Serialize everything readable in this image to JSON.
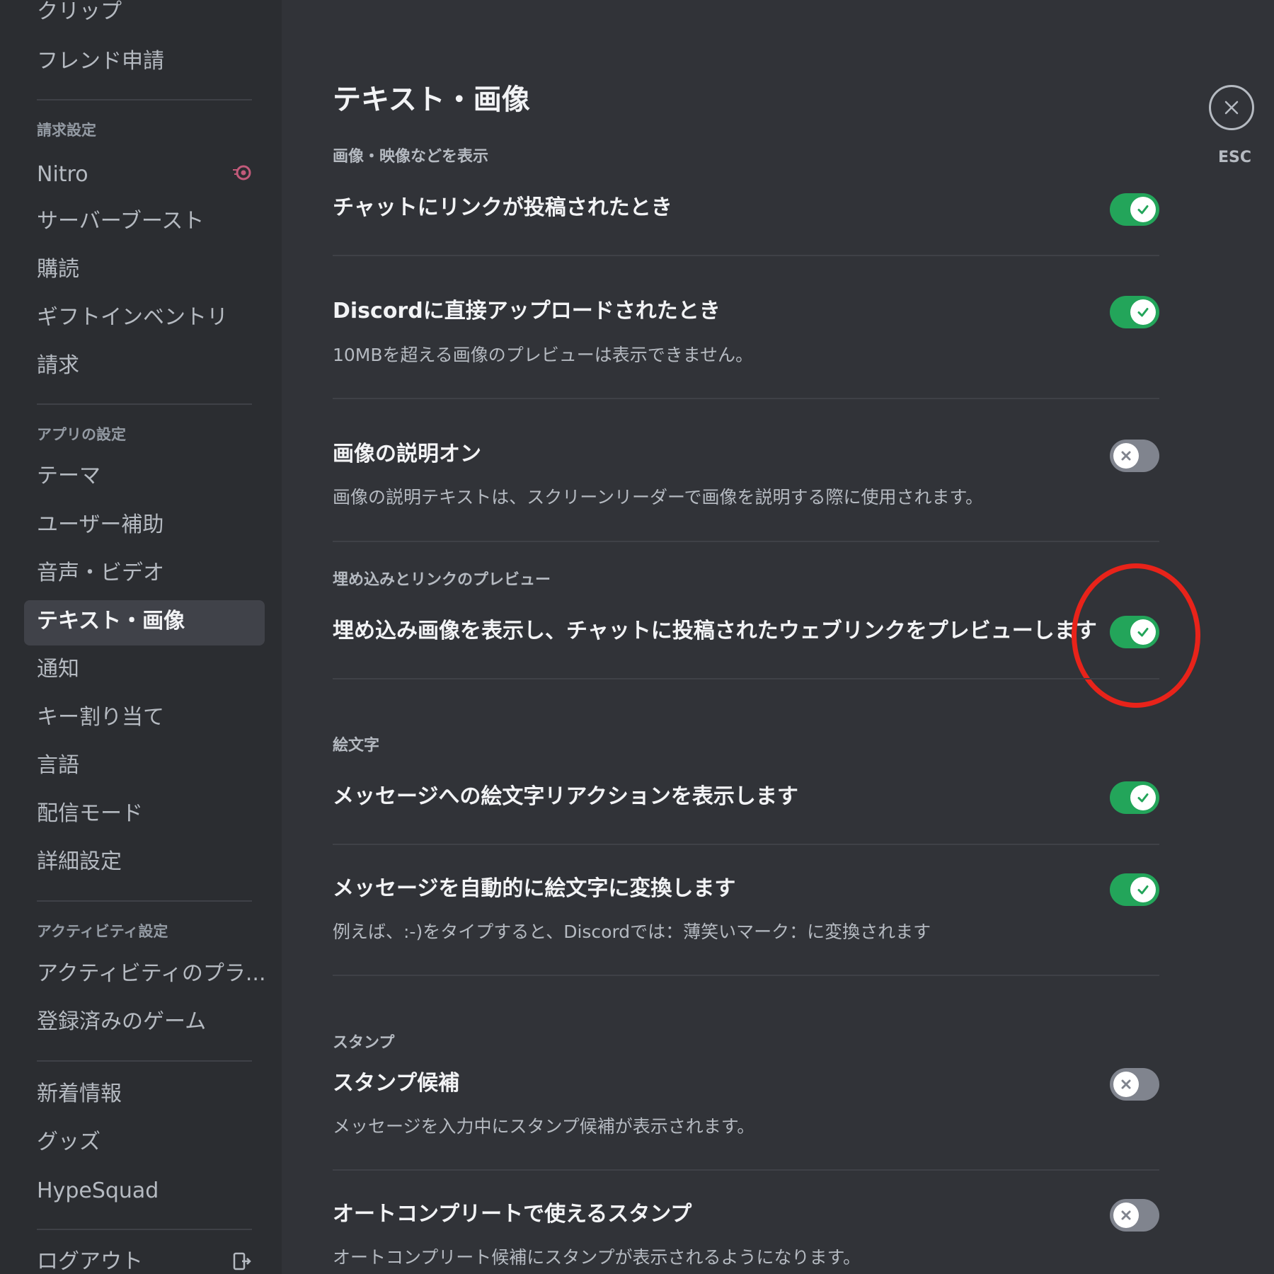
{
  "sidebar": {
    "items_top": [
      "クリップ",
      "フレンド申請"
    ],
    "billing_header": "請求設定",
    "billing_items": [
      "Nitro",
      "サーバーブースト",
      "購読",
      "ギフトインベントリ",
      "請求"
    ],
    "app_header": "アプリの設定",
    "app_items": [
      "テーマ",
      "ユーザー補助",
      "音声・ビデオ",
      "テキスト・画像",
      "通知",
      "キー割り当て",
      "言語",
      "配信モード",
      "詳細設定"
    ],
    "activity_header": "アクティビティ設定",
    "activity_items": [
      "アクティビティのプラ...",
      "登録済みのゲーム"
    ],
    "misc_items": [
      "新着情報",
      "グッズ",
      "HypeSquad"
    ],
    "logout": "ログアウト",
    "selected": "テキスト・画像",
    "nitro_icon": "nitro-badge-icon",
    "logout_icon": "logout-icon"
  },
  "main": {
    "title": "テキスト・画像",
    "sections": {
      "media": "画像・映像などを表示",
      "embeds": "埋め込みとリンクのプレビュー",
      "emoji": "絵文字",
      "stickers": "スタンプ"
    },
    "rows": [
      {
        "title": "チャットにリンクが投稿されたとき",
        "desc": "",
        "on": true
      },
      {
        "title": "Discordに直接アップロードされたとき",
        "desc": "10MBを超える画像のプレビューは表示できません。",
        "on": true
      },
      {
        "title": "画像の説明オン",
        "desc": "画像の説明テキストは、スクリーンリーダーで画像を説明する際に使用されます。",
        "on": false
      },
      {
        "title": "埋め込み画像を表示し、チャットに投稿されたウェブリンクをプレビューします",
        "desc": "",
        "on": true
      },
      {
        "title": "メッセージへの絵文字リアクションを表示します",
        "desc": "",
        "on": true
      },
      {
        "title": "メッセージを自動的に絵文字に変換します",
        "desc": "例えば、:-)をタイプすると、Discordでは：薄笑いマーク：に変換されます",
        "on": true
      },
      {
        "title": "スタンプ候補",
        "desc": "メッセージを入力中にスタンプ候補が表示されます。",
        "on": false
      },
      {
        "title": "オートコンプリートで使えるスタンプ",
        "desc": "オートコンプリート候補にスタンプが表示されるようになります。",
        "on": false
      }
    ]
  },
  "close": {
    "label": "ESC",
    "icon": "close-icon"
  },
  "colors": {
    "toggle_on": "#23a55a",
    "toggle_off": "#80848e",
    "highlight": "#e8231a"
  }
}
